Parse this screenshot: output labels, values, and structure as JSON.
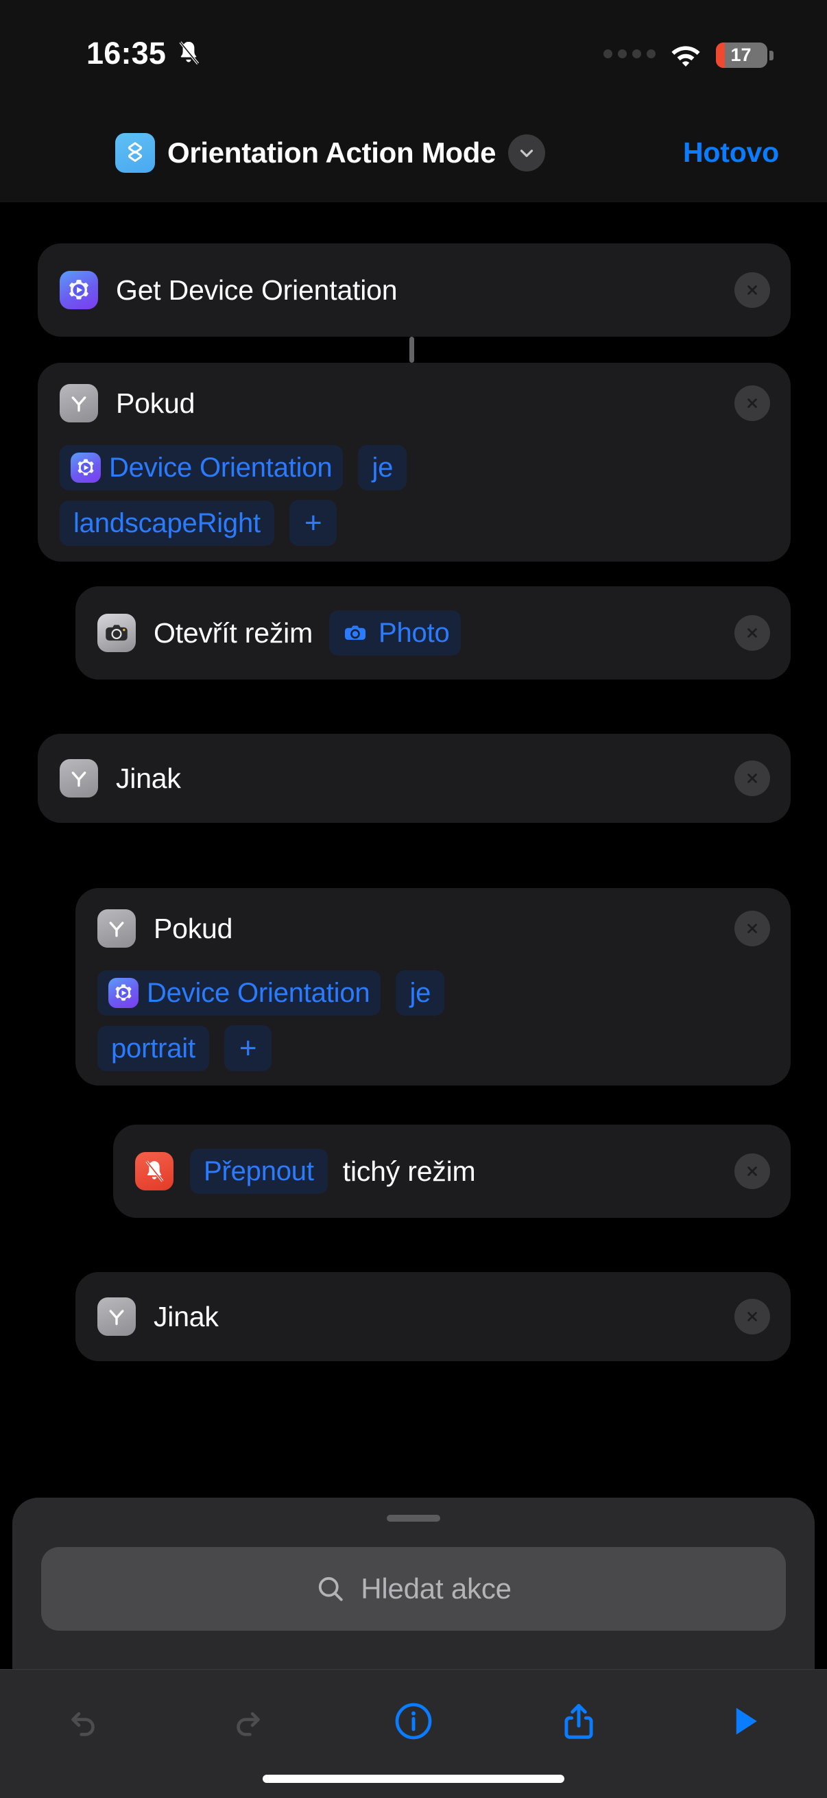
{
  "status_bar": {
    "time": "16:35",
    "silent_icon": "bell-slash-icon",
    "signal_icon": "cellular-dots-icon",
    "wifi_icon": "wifi-icon",
    "battery_level": "17",
    "battery_percent": 17,
    "battery_color": "#ef4a31"
  },
  "header": {
    "app_icon": "shortcuts-icon",
    "title": "Orientation Action Mode",
    "chevron_icon": "chevron-down-icon",
    "done_label": "Hotovo",
    "accent_color": "#0a7cff"
  },
  "actions": [
    {
      "id": "get-device-orientation",
      "icon": "gear-play-icon",
      "icon_style": "gear",
      "title": "Get Device Orientation",
      "indent": 0,
      "remove_icon": "close-icon"
    },
    {
      "id": "if-landscape-right",
      "icon": "fork-branch-icon",
      "icon_style": "grayfork",
      "title": "Pokud",
      "indent": 0,
      "remove_icon": "close-icon",
      "condition": {
        "variable_icon": "gear-play-icon",
        "variable": "Device Orientation",
        "operator": "je",
        "value": "landscapeRight",
        "add_label": "+"
      }
    },
    {
      "id": "open-camera-mode",
      "icon": "camera-icon",
      "icon_style": "camera",
      "title": "Otevřít režim",
      "indent": 1,
      "remove_icon": "close-icon",
      "param": {
        "icon": "camera-blue-icon",
        "label": "Photo"
      }
    },
    {
      "id": "else-outer",
      "icon": "fork-branch-icon",
      "icon_style": "grayfork",
      "title": "Jinak",
      "indent": 0,
      "remove_icon": "close-icon"
    },
    {
      "id": "if-portrait",
      "icon": "fork-branch-icon",
      "icon_style": "grayfork",
      "title": "Pokud",
      "indent": 1,
      "remove_icon": "close-icon",
      "condition": {
        "variable_icon": "gear-play-icon",
        "variable": "Device Orientation",
        "operator": "je",
        "value": "portrait",
        "add_label": "+"
      }
    },
    {
      "id": "toggle-silent-mode",
      "icon": "bell-slash-red-icon",
      "icon_style": "redbell",
      "title": "",
      "indent": 2,
      "remove_icon": "close-icon",
      "prefix_pill": "Přepnout",
      "suffix_text": "tichý režim"
    },
    {
      "id": "else-inner",
      "icon": "fork-branch-icon",
      "icon_style": "grayfork",
      "title": "Jinak",
      "indent": 1,
      "remove_icon": "close-icon"
    }
  ],
  "sheet": {
    "grabber": "drag-handle",
    "search": {
      "icon": "search-icon",
      "placeholder": "Hledat akce",
      "value": ""
    }
  },
  "toolbar": {
    "items": [
      {
        "name": "undo-button",
        "icon": "undo-icon",
        "enabled": false
      },
      {
        "name": "redo-button",
        "icon": "redo-icon",
        "enabled": false
      },
      {
        "name": "info-button",
        "icon": "info-icon",
        "enabled": true
      },
      {
        "name": "share-button",
        "icon": "share-icon",
        "enabled": true
      },
      {
        "name": "run-button",
        "icon": "play-icon",
        "enabled": true
      }
    ],
    "disabled_color": "#4d4d4f",
    "enabled_color": "#0a7cff"
  }
}
